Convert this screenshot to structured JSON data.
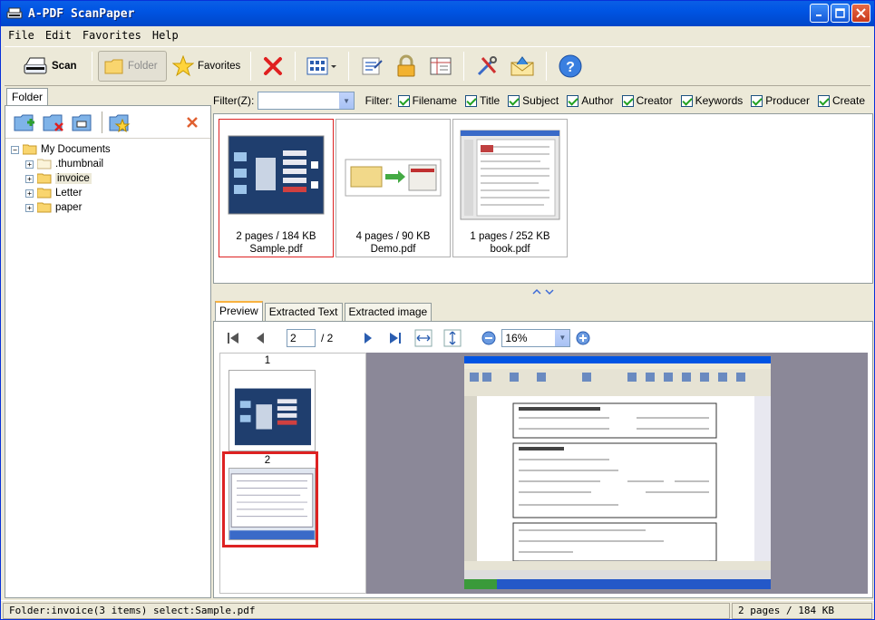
{
  "window": {
    "title": "A-PDF ScanPaper"
  },
  "menu": [
    "File",
    "Edit",
    "Favorites",
    "Help"
  ],
  "toolbar": {
    "scan_label": "Scan",
    "folder_label": "Folder",
    "favorites_label": "Favorites"
  },
  "left_panel": {
    "tab_label": "Folder",
    "tree": {
      "root": "My Documents",
      "children": [
        ".thumbnail",
        "invoice",
        "Letter",
        "paper"
      ]
    }
  },
  "filter": {
    "label": "Filter(Z):",
    "value": "",
    "filter_label": "Filter:",
    "options": [
      "Filename",
      "Title",
      "Subject",
      "Author",
      "Creator",
      "Keywords",
      "Producer",
      "Create"
    ]
  },
  "files": [
    {
      "info": "2 pages / 184 KB",
      "name": "Sample.pdf"
    },
    {
      "info": "4 pages / 90 KB",
      "name": "Demo.pdf"
    },
    {
      "info": "1 pages / 252 KB",
      "name": "book.pdf"
    }
  ],
  "preview_tabs": [
    "Preview",
    "Extracted Text",
    "Extracted image"
  ],
  "navigation": {
    "current_page": "2",
    "page_total": "/ 2",
    "zoom": "16%"
  },
  "page_thumbs": [
    "1",
    "2"
  ],
  "status": {
    "left": "Folder:invoice(3 items) select:Sample.pdf",
    "right": "2 pages / 184 KB"
  },
  "colors": {
    "titlebar": "#0054E3",
    "selection": "#DD2222",
    "viewer_bg": "#8B8898"
  }
}
